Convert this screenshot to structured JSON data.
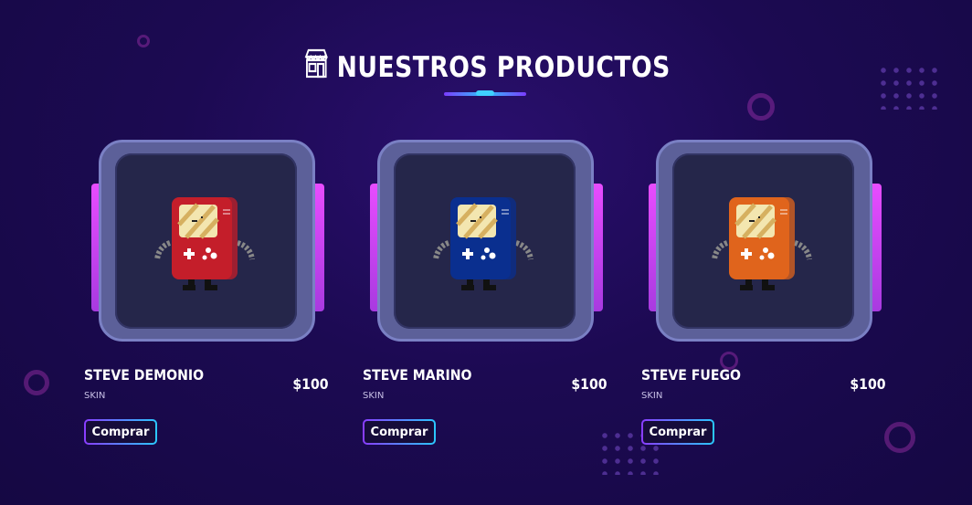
{
  "header": {
    "title": "NUESTROS PRODUCTOS",
    "icon": "store-icon"
  },
  "colors": {
    "accent": "#2ec5ff",
    "purple": "#8a3cff",
    "frame": "#5c6099"
  },
  "products": [
    {
      "name": "STEVE DEMONIO",
      "type": "SKIN",
      "price": "$100",
      "button": "Comprar",
      "color": "#c41e2a",
      "image": "red-gameboy-robot"
    },
    {
      "name": "STEVE MARINO",
      "type": "SKIN",
      "price": "$100",
      "button": "Comprar",
      "color": "#0a2f8f",
      "image": "blue-gameboy-robot"
    },
    {
      "name": "STEVE FUEGO",
      "type": "SKIN",
      "price": "$100",
      "button": "Comprar",
      "color": "#e0641c",
      "image": "orange-gameboy-robot"
    }
  ]
}
